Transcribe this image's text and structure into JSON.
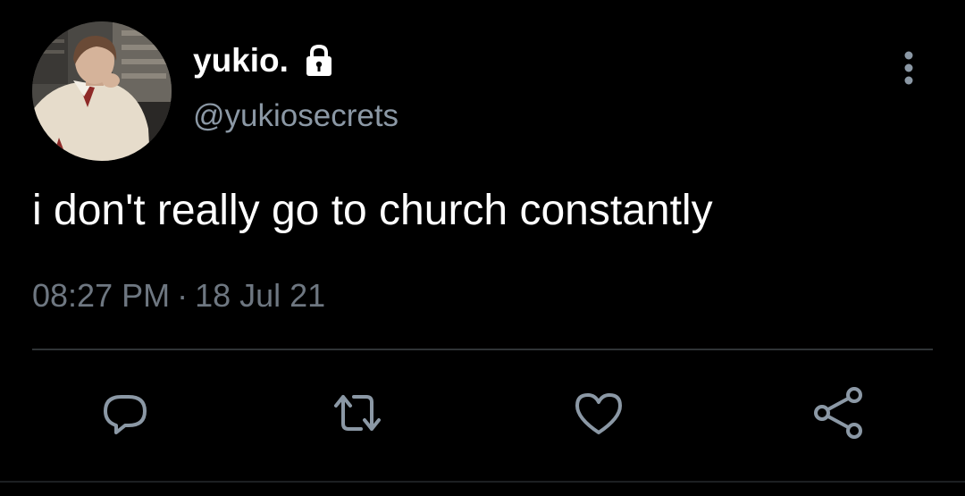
{
  "tweet": {
    "display_name": "yukio.",
    "handle": "@yukiosecrets",
    "text": "i don't really go to church constantly",
    "time": "08:27 PM",
    "separator": "·",
    "date": "18 Jul 21",
    "protected": true
  },
  "icons": {
    "lock": "lock-icon",
    "more": "more-vertical-icon",
    "reply": "reply-icon",
    "retweet": "retweet-icon",
    "like": "heart-icon",
    "share": "share-icon"
  },
  "colors": {
    "background": "#000000",
    "text_primary": "#ffffff",
    "text_secondary": "#8b98a5",
    "text_meta": "#6e7781",
    "icon": "#8b98a5",
    "divider": "#2f3336"
  }
}
